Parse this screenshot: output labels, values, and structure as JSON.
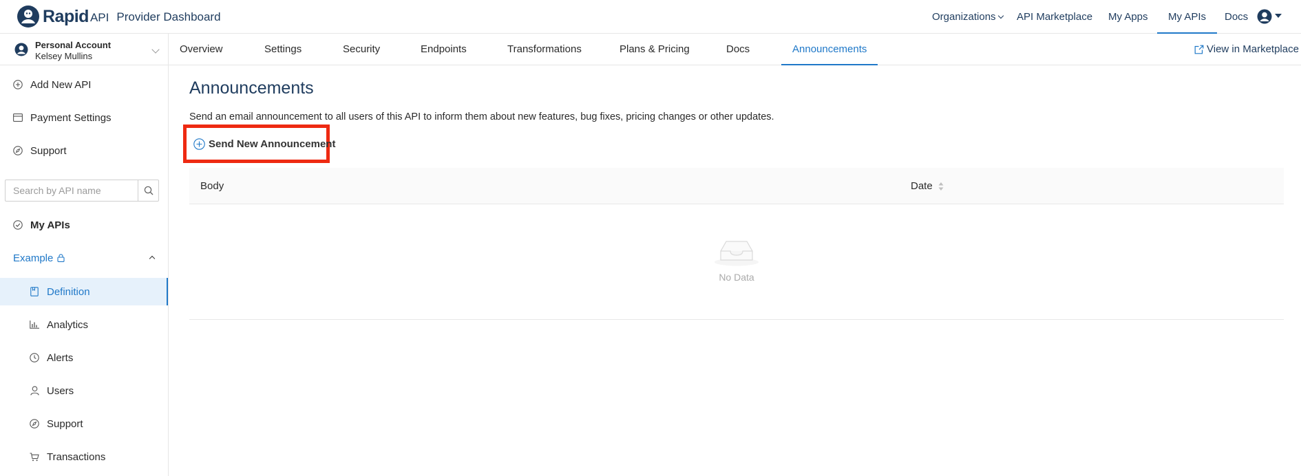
{
  "brand": {
    "name": "Rapid",
    "suffix": "API",
    "product": "Provider Dashboard"
  },
  "topnav": {
    "items": [
      {
        "label": "Organizations",
        "has_dropdown": true
      },
      {
        "label": "API Marketplace"
      },
      {
        "label": "My Apps"
      },
      {
        "label": "My APIs",
        "active": true
      },
      {
        "label": "Docs"
      }
    ],
    "user_icon": "user-avatar-icon"
  },
  "account": {
    "label": "Personal Account",
    "name": "Kelsey Mullins"
  },
  "sidebar": {
    "items": [
      {
        "label": "Add New API",
        "icon": "plus-circle-icon"
      },
      {
        "label": "Payment Settings",
        "icon": "credit-card-icon"
      },
      {
        "label": "Support",
        "icon": "compass-icon"
      }
    ],
    "search_placeholder": "Search by API name",
    "my_apis_label": "My APIs",
    "api_name": "Example",
    "api_subitems": [
      {
        "label": "Definition",
        "icon": "document-icon",
        "selected": true
      },
      {
        "label": "Analytics",
        "icon": "bar-chart-icon"
      },
      {
        "label": "Alerts",
        "icon": "clock-icon"
      },
      {
        "label": "Users",
        "icon": "user-icon"
      },
      {
        "label": "Support",
        "icon": "compass-icon"
      },
      {
        "label": "Transactions",
        "icon": "cart-icon"
      }
    ]
  },
  "tabs": {
    "items": [
      {
        "label": "Overview"
      },
      {
        "label": "Settings"
      },
      {
        "label": "Security"
      },
      {
        "label": "Endpoints"
      },
      {
        "label": "Transformations"
      },
      {
        "label": "Plans & Pricing"
      },
      {
        "label": "Docs"
      },
      {
        "label": "Announcements",
        "active": true
      }
    ],
    "view_in_marketplace": "View in Marketplace"
  },
  "main": {
    "title": "Announcements",
    "description": "Send an email announcement to all users of this API to inform them about new features, bug fixes, pricing changes or other updates.",
    "send_button": "Send New Announcement",
    "table": {
      "columns": [
        "Body",
        "Date"
      ],
      "empty_text": "No Data"
    }
  },
  "colors": {
    "accent": "#1f78c8",
    "navy": "#1f3c5e",
    "highlight_box": "#ee2a12",
    "selected_bg": "#e6f1fb"
  }
}
